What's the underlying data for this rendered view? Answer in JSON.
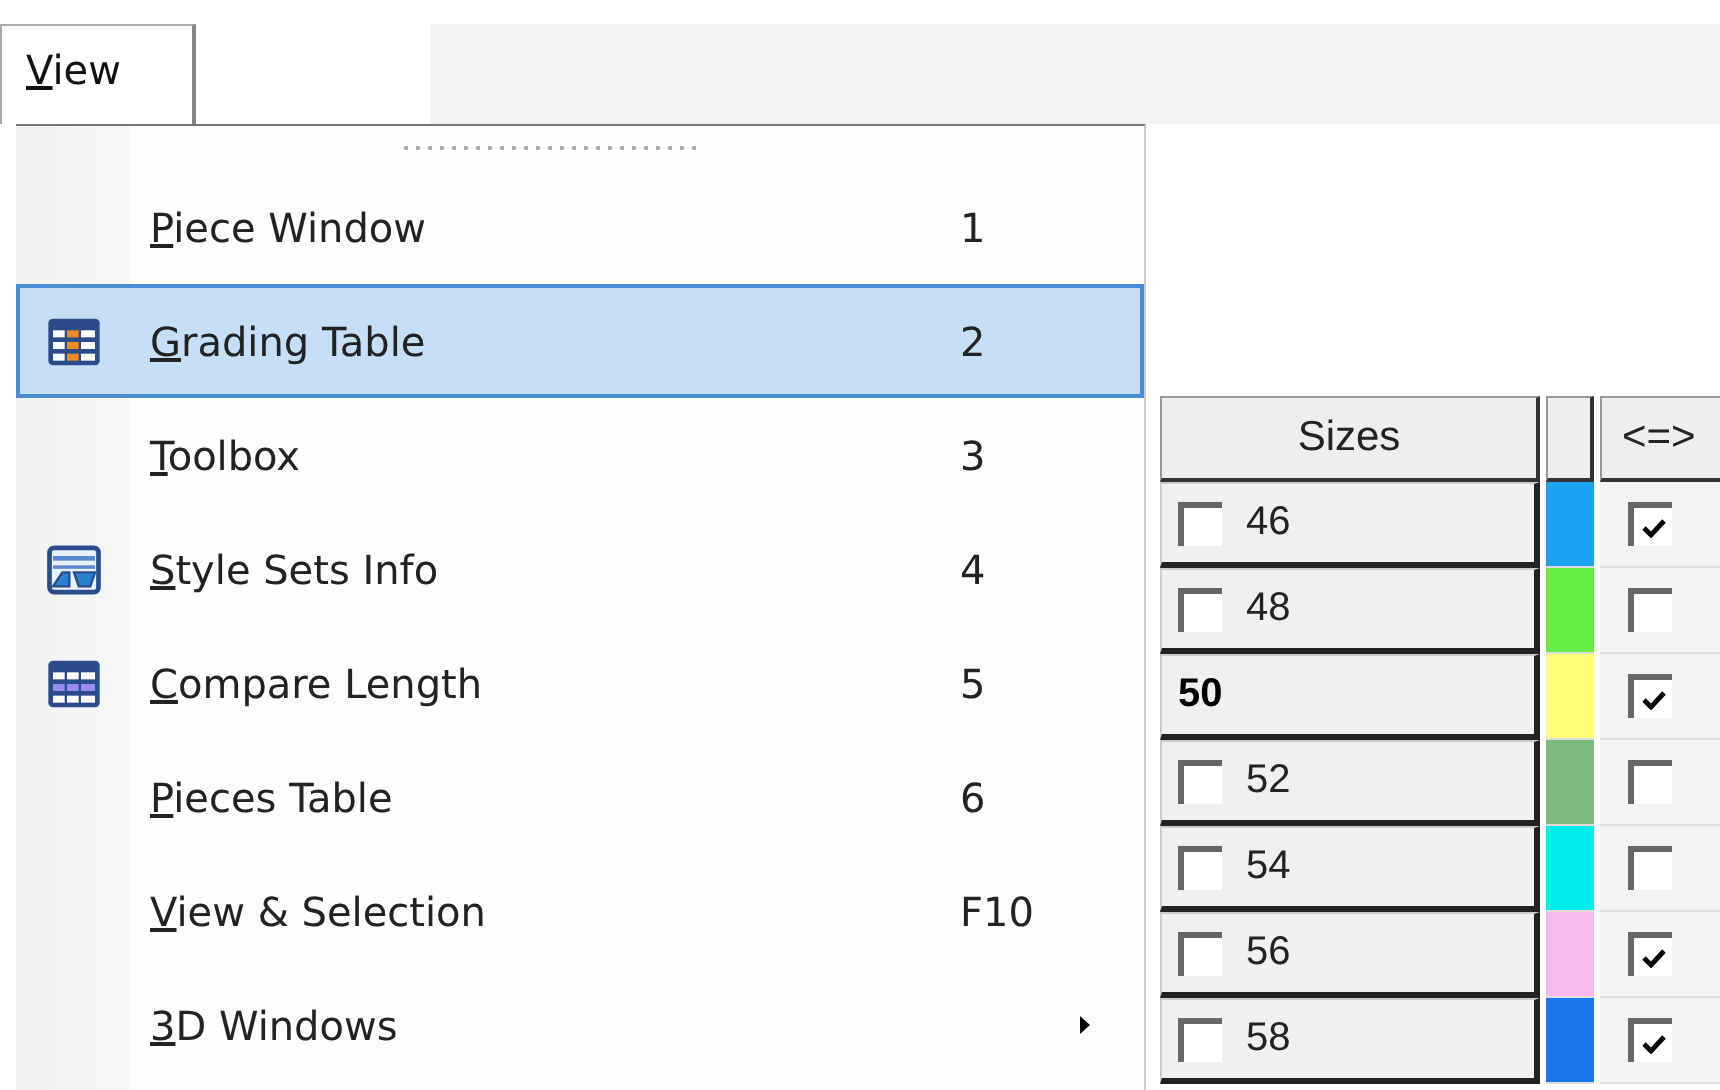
{
  "menu_bar": {
    "menu": {
      "label": "View",
      "underline_first": true,
      "open": true
    }
  },
  "menu": {
    "items": [
      {
        "label": "Piece Window",
        "underline_first": true,
        "shortcut": "1",
        "kind": "plain",
        "selected": false,
        "submenu": false
      },
      {
        "label": "Grading Table",
        "underline_first": true,
        "shortcut": "2",
        "kind": "table",
        "selected": true,
        "submenu": false
      },
      {
        "label": "Toolbox",
        "underline_first": true,
        "shortcut": "3",
        "kind": "plain",
        "selected": false,
        "submenu": false
      },
      {
        "label": "Style Sets Info",
        "underline_first": true,
        "shortcut": "4",
        "kind": "sets",
        "selected": false,
        "submenu": false
      },
      {
        "label": "Compare Length",
        "underline_first": true,
        "shortcut": "5",
        "kind": "compare",
        "selected": false,
        "submenu": false
      },
      {
        "label": "Pieces Table",
        "underline_first": true,
        "shortcut": "6",
        "kind": "plain",
        "selected": false,
        "submenu": false
      },
      {
        "label": "View & Selection",
        "underline_first": true,
        "shortcut": "F10",
        "kind": "plain",
        "selected": false,
        "submenu": false
      },
      {
        "label": "3D Windows",
        "underline_first": true,
        "kind": "plain",
        "selected": false,
        "submenu": true
      }
    ]
  },
  "grading_table": {
    "columns": [
      "Sizes",
      "<=>"
    ],
    "rows": [
      {
        "kind": "size",
        "size": "46",
        "checked": false,
        "color": "#1aa3f0",
        "compare": true
      },
      {
        "kind": "size",
        "size": "48",
        "checked": false,
        "color": "#66ee44",
        "compare": false
      },
      {
        "kind": "base",
        "size": "50",
        "color": "#ffff77",
        "compare": true
      },
      {
        "kind": "size",
        "size": "52",
        "checked": false,
        "color": "#7dbb7d",
        "compare": false
      },
      {
        "kind": "size",
        "size": "54",
        "checked": false,
        "color": "#00eeee",
        "compare": false
      },
      {
        "kind": "size",
        "size": "56",
        "checked": false,
        "color": "#f8b8f0",
        "compare": true
      },
      {
        "kind": "size",
        "size": "58",
        "checked": false,
        "color": "#1a75f0",
        "compare": true
      }
    ]
  }
}
